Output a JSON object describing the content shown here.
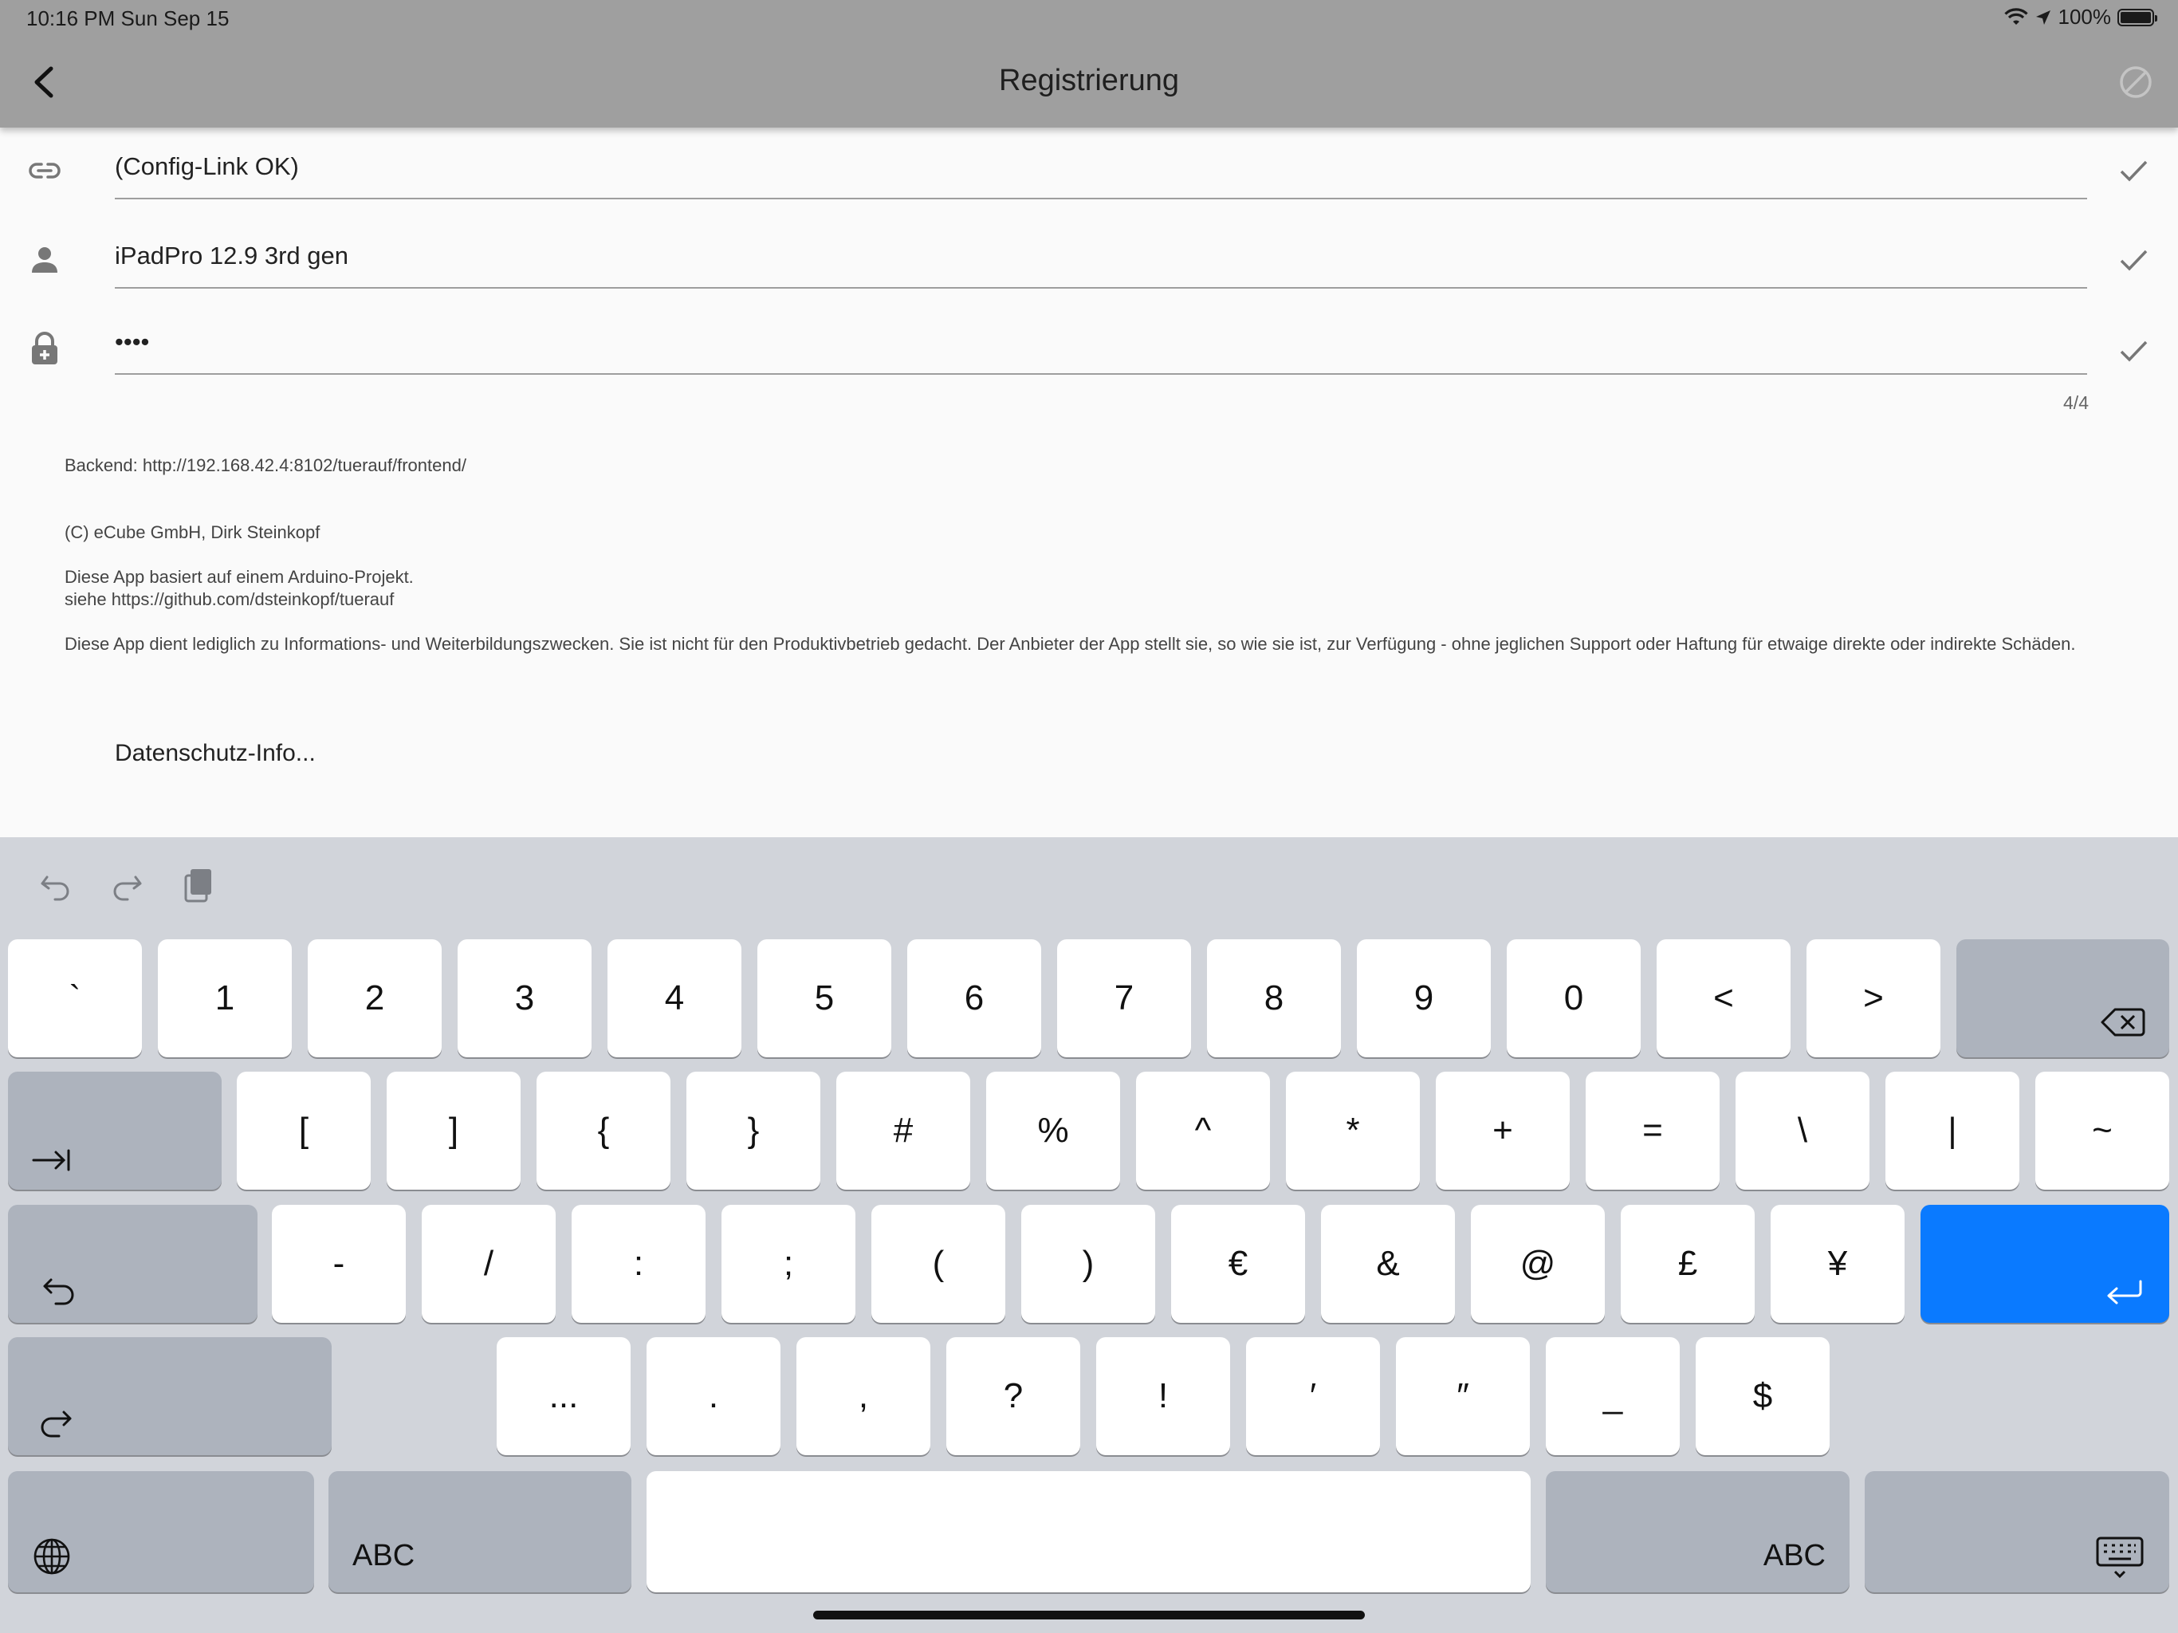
{
  "status": {
    "time": "10:16 PM   Sun Sep 15",
    "battery": "100%"
  },
  "nav": {
    "title": "Registrierung"
  },
  "form": {
    "config_link": "(Config-Link OK)",
    "user": "iPadPro 12.9 3rd gen",
    "password_masked": "••••",
    "counter": "4/4"
  },
  "info": {
    "backend": "Backend: http://192.168.42.4:8102/tuerauf/frontend/",
    "copyright": "(C) eCube GmbH, Dirk Steinkopf",
    "arduino_1": "Diese App basiert auf einem Arduino-Projekt.",
    "arduino_2": "siehe https://github.com/dsteinkopf/tuerauf",
    "disclaimer": "Diese App dient lediglich zu Informations- und Weiterbildungszwecken. Sie ist nicht für den Produktivbetrieb gedacht. Der Anbieter der App stellt sie, so wie sie ist, zur Verfügung - ohne jeglichen Support oder Haftung für etwaige direkte oder indirekte Schäden."
  },
  "links": {
    "datenschutz": "Datenschutz-Info..."
  },
  "keyboard": {
    "row1": [
      "`",
      "1",
      "2",
      "3",
      "4",
      "5",
      "6",
      "7",
      "8",
      "9",
      "0",
      "<",
      ">"
    ],
    "row2": [
      "[",
      "]",
      "{",
      "}",
      "#",
      "%",
      "^",
      "*",
      "+",
      "=",
      "\\",
      "|",
      "~"
    ],
    "row3": [
      "-",
      "/",
      ":",
      ";",
      "(",
      ")",
      "€",
      "&",
      "@",
      "£",
      "¥"
    ],
    "row4": [
      "...",
      ".",
      ",",
      "?",
      "!",
      "′",
      "″",
      "_",
      "$"
    ],
    "abc_left": "ABC",
    "abc_right": "ABC"
  }
}
